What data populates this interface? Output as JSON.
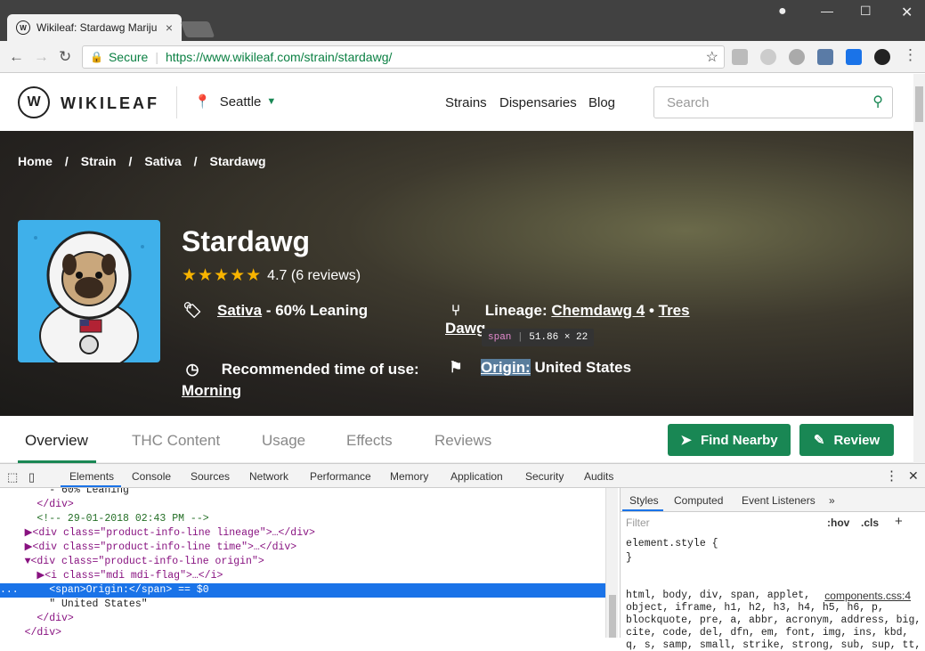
{
  "browser": {
    "tab_title": "Wikileaf: Stardawg Mariju",
    "tab_close": "×",
    "secure_label": "Secure",
    "url": "https://www.wikileaf.com/strain/stardawg/"
  },
  "site": {
    "logo_text": "WIKILEAF",
    "location": "Seattle",
    "nav": [
      "Strains",
      "Dispensaries",
      "Blog"
    ],
    "search_placeholder": "Search"
  },
  "breadcrumb": [
    "Home",
    "Strain",
    "Sativa",
    "Stardawg"
  ],
  "strain": {
    "name": "Stardawg",
    "rating": "4.7",
    "reviews": "(6 reviews)",
    "type_link": "Sativa",
    "type_suffix": " - 60% Leaning",
    "lineage_label": "Lineage: ",
    "lineage_1": "Chemdawg 4",
    "lineage_sep": " • ",
    "lineage_2a": "Tres",
    "lineage_2b": "Dawg",
    "time_label": "Recommended time of use:",
    "time_value": "Morning",
    "origin_label": "Origin:",
    "origin_value": " United States"
  },
  "tooltip": {
    "tag": "span",
    "size": "51.86 × 22"
  },
  "tabs": [
    "Overview",
    "THC Content",
    "Usage",
    "Effects",
    "Reviews"
  ],
  "buttons": {
    "find_nearby": "Find Nearby",
    "review": "Review"
  },
  "devtools": {
    "tabs": [
      "Elements",
      "Console",
      "Sources",
      "Network",
      "Performance",
      "Memory",
      "Application",
      "Security",
      "Audits"
    ],
    "code_lines": [
      {
        "text": "        - 60% Leaning",
        "cls": "tx"
      },
      {
        "text": "      </div>",
        "cls": ""
      },
      {
        "text": "      <!-- 29-01-2018 02:43 PM -->",
        "cls": "cm"
      },
      {
        "text": "    ▶<div class=\"product-info-line lineage\">…</div>",
        "cls": ""
      },
      {
        "text": "    ▶<div class=\"product-info-line time\">…</div>",
        "cls": ""
      },
      {
        "text": "    ▼<div class=\"product-info-line origin\">",
        "cls": ""
      },
      {
        "text": "      ▶<i class=\"mdi mdi-flag\">…</i>",
        "cls": ""
      },
      {
        "text": "        <span>Origin:</span> == $0",
        "cls": "sel"
      },
      {
        "text": "        \" United States\"",
        "cls": "tx"
      },
      {
        "text": "      </div>",
        "cls": ""
      },
      {
        "text": "    </div>",
        "cls": ""
      }
    ],
    "selected_prefix": "...",
    "styles_tabs": [
      "Styles",
      "Computed",
      "Event Listeners",
      "»"
    ],
    "filter_placeholder": "Filter",
    "hov": ":hov",
    "cls": ".cls",
    "plus": "+",
    "rule_element_style": "element.style {",
    "rule_close": "}",
    "css_source": "components.css:4",
    "css_lines": [
      "html, body, div, span, applet,",
      "object, iframe, h1, h2, h3, h4, h5, h6, p,",
      "blockquote, pre, a, abbr, acronym, address, big,",
      "cite, code, del, dfn, em, font, img, ins, kbd,",
      "q, s, samp, small, strike, strong, sub, sup, tt,"
    ]
  }
}
